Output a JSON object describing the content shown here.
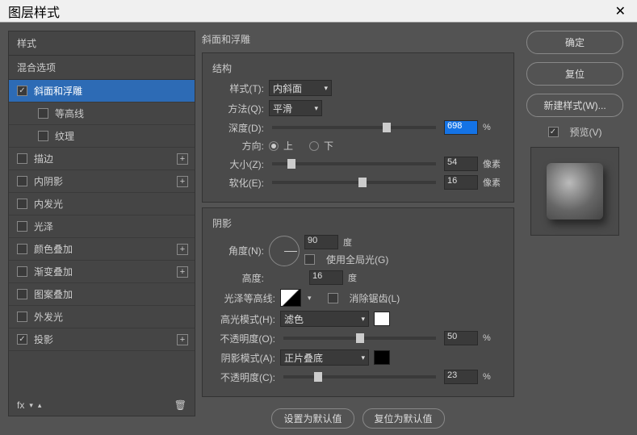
{
  "window": {
    "title": "图层样式"
  },
  "left": {
    "styles_header": "样式",
    "blend_header": "混合选项",
    "items": [
      {
        "label": "斜面和浮雕",
        "checked": true,
        "selected": true,
        "plus": false,
        "indent": false
      },
      {
        "label": "等高线",
        "checked": false,
        "selected": false,
        "plus": false,
        "indent": true
      },
      {
        "label": "纹理",
        "checked": false,
        "selected": false,
        "plus": false,
        "indent": true
      },
      {
        "label": "描边",
        "checked": false,
        "selected": false,
        "plus": true,
        "indent": false
      },
      {
        "label": "内阴影",
        "checked": false,
        "selected": false,
        "plus": true,
        "indent": false
      },
      {
        "label": "内发光",
        "checked": false,
        "selected": false,
        "plus": false,
        "indent": false
      },
      {
        "label": "光泽",
        "checked": false,
        "selected": false,
        "plus": false,
        "indent": false
      },
      {
        "label": "颜色叠加",
        "checked": false,
        "selected": false,
        "plus": true,
        "indent": false
      },
      {
        "label": "渐变叠加",
        "checked": false,
        "selected": false,
        "plus": true,
        "indent": false
      },
      {
        "label": "图案叠加",
        "checked": false,
        "selected": false,
        "plus": false,
        "indent": false
      },
      {
        "label": "外发光",
        "checked": false,
        "selected": false,
        "plus": false,
        "indent": false
      },
      {
        "label": "投影",
        "checked": true,
        "selected": false,
        "plus": true,
        "indent": false
      }
    ],
    "fx_label": "fx"
  },
  "mid": {
    "main_title": "斜面和浮雕",
    "structure": {
      "title": "结构",
      "style_label": "样式(T):",
      "style_value": "内斜面",
      "method_label": "方法(Q):",
      "method_value": "平滑",
      "depth_label": "深度(D):",
      "depth_value": "698",
      "depth_unit": "%",
      "direction_label": "方向:",
      "up": "上",
      "down": "下",
      "size_label": "大小(Z):",
      "size_value": "54",
      "size_unit": "像素",
      "soften_label": "软化(E):",
      "soften_value": "16",
      "soften_unit": "像素"
    },
    "shading": {
      "title": "阴影",
      "angle_label": "角度(N):",
      "angle_value": "90",
      "angle_unit": "度",
      "global_light": "使用全局光(G)",
      "altitude_label": "高度:",
      "altitude_value": "16",
      "altitude_unit": "度",
      "gloss_label": "光泽等高线:",
      "antialias": "消除锯齿(L)",
      "highlight_mode_label": "高光模式(H):",
      "highlight_mode_value": "滤色",
      "highlight_opacity_label": "不透明度(O):",
      "highlight_opacity_value": "50",
      "opacity_unit": "%",
      "shadow_mode_label": "阴影模式(A):",
      "shadow_mode_value": "正片叠底",
      "shadow_opacity_label": "不透明度(C):",
      "shadow_opacity_value": "23",
      "highlight_color": "#ffffff",
      "shadow_color": "#000000"
    },
    "buttons": {
      "default": "设置为默认值",
      "reset": "复位为默认值"
    }
  },
  "right": {
    "ok": "确定",
    "cancel": "复位",
    "new_style": "新建样式(W)...",
    "preview_label": "预览(V)"
  }
}
